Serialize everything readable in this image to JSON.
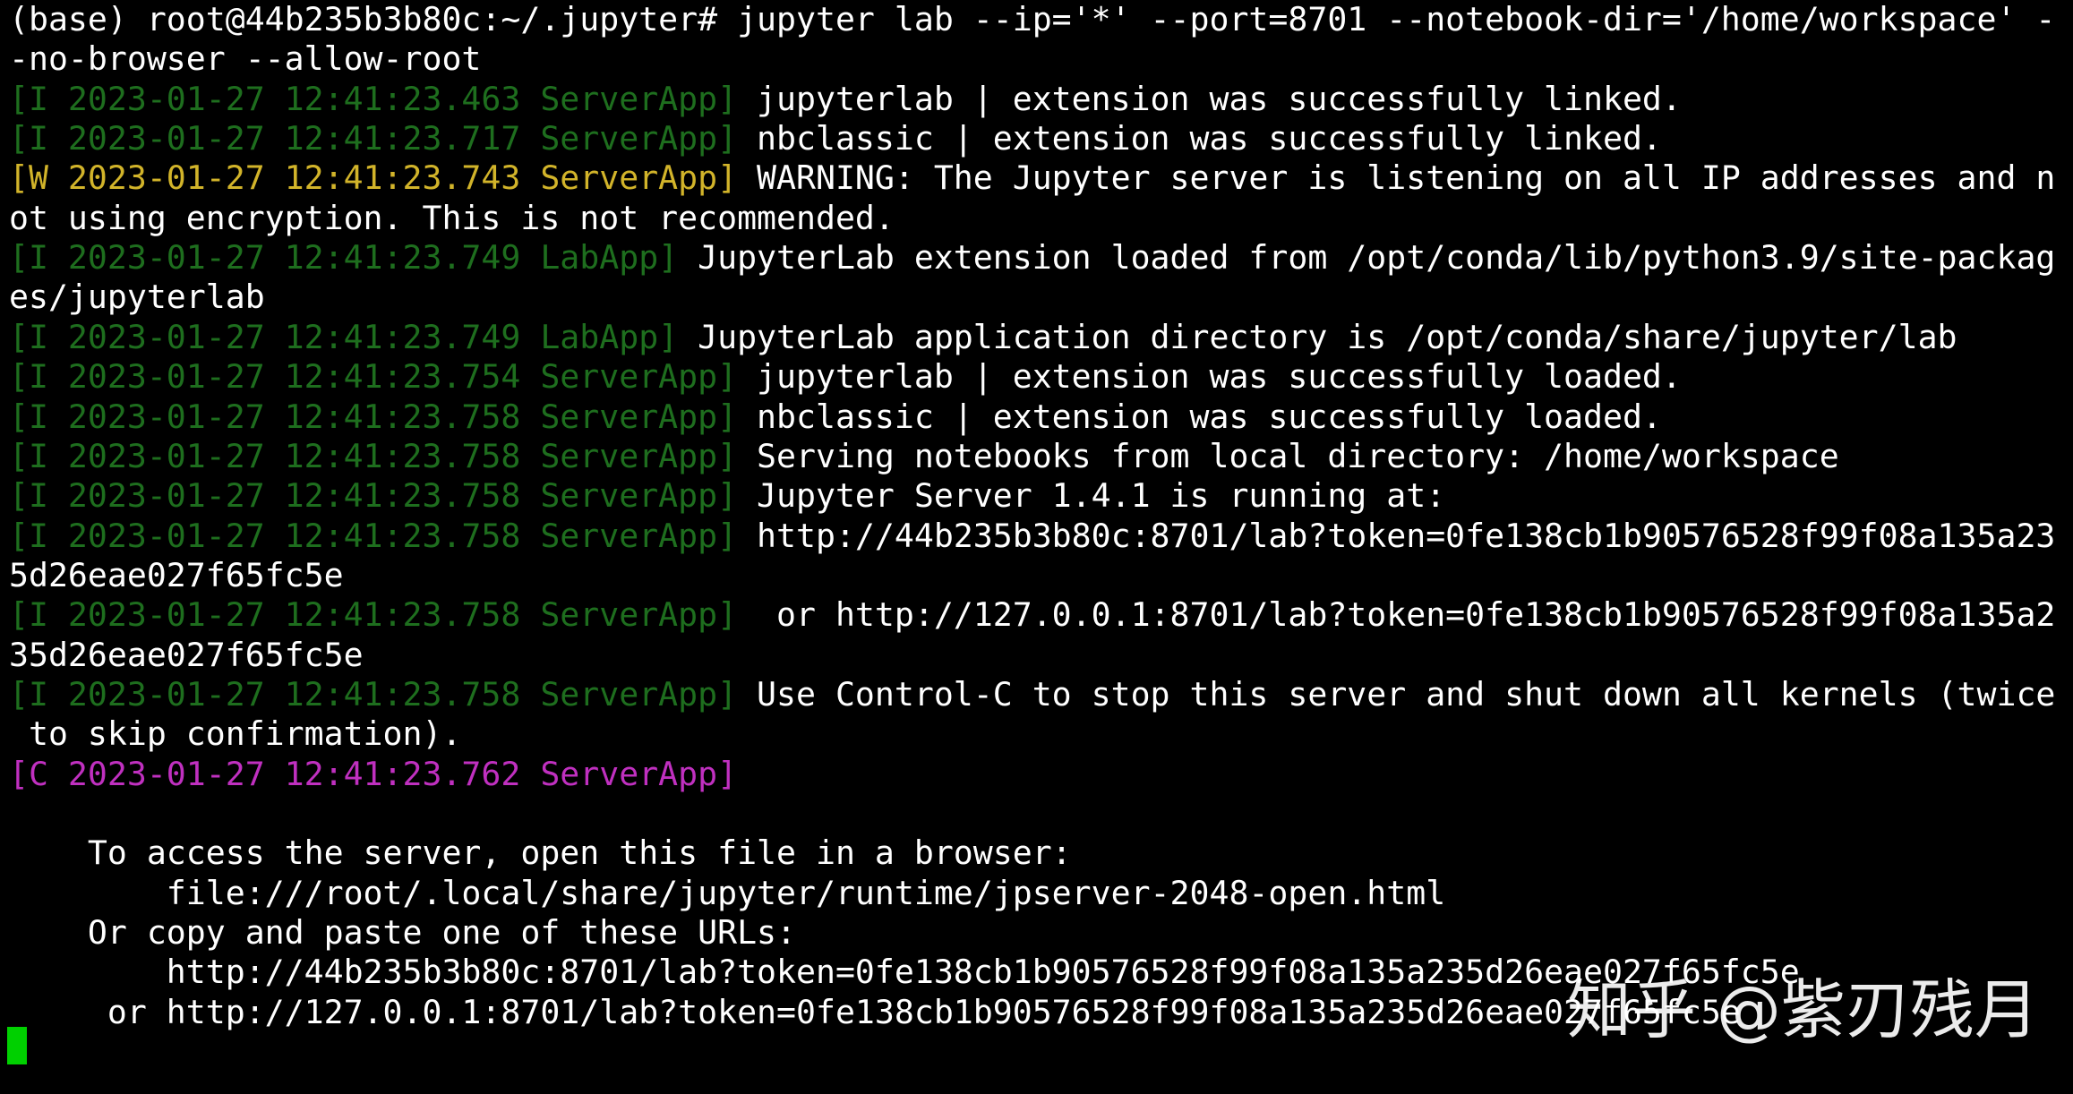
{
  "terminal": {
    "lines": [
      {
        "kind": "plain",
        "text": "(base) root@44b235b3b80c:~/.jupyter# jupyter lab --ip='*' --port=8701 --notebook-dir='/home/workspace' -"
      },
      {
        "kind": "plain",
        "text": "-no-browser --allow-root"
      },
      {
        "kind": "info",
        "tag": "[I 2023-01-27 12:41:23.463 ServerApp]",
        "message": " jupyterlab | extension was successfully linked."
      },
      {
        "kind": "info",
        "tag": "[I 2023-01-27 12:41:23.717 ServerApp]",
        "message": " nbclassic | extension was successfully linked."
      },
      {
        "kind": "warn",
        "tag": "[W 2023-01-27 12:41:23.743 ServerApp]",
        "message": " WARNING: The Jupyter server is listening on all IP addresses and n"
      },
      {
        "kind": "plain",
        "text": "ot using encryption. This is not recommended."
      },
      {
        "kind": "info",
        "tag": "[I 2023-01-27 12:41:23.749 LabApp]",
        "message": " JupyterLab extension loaded from /opt/conda/lib/python3.9/site-packag"
      },
      {
        "kind": "plain",
        "text": "es/jupyterlab"
      },
      {
        "kind": "info",
        "tag": "[I 2023-01-27 12:41:23.749 LabApp]",
        "message": " JupyterLab application directory is /opt/conda/share/jupyter/lab"
      },
      {
        "kind": "info",
        "tag": "[I 2023-01-27 12:41:23.754 ServerApp]",
        "message": " jupyterlab | extension was successfully loaded."
      },
      {
        "kind": "info",
        "tag": "[I 2023-01-27 12:41:23.758 ServerApp]",
        "message": " nbclassic | extension was successfully loaded."
      },
      {
        "kind": "info",
        "tag": "[I 2023-01-27 12:41:23.758 ServerApp]",
        "message": " Serving notebooks from local directory: /home/workspace"
      },
      {
        "kind": "info",
        "tag": "[I 2023-01-27 12:41:23.758 ServerApp]",
        "message": " Jupyter Server 1.4.1 is running at:"
      },
      {
        "kind": "info",
        "tag": "[I 2023-01-27 12:41:23.758 ServerApp]",
        "message": " http://44b235b3b80c:8701/lab?token=0fe138cb1b90576528f99f08a135a23"
      },
      {
        "kind": "plain",
        "text": "5d26eae027f65fc5e"
      },
      {
        "kind": "info",
        "tag": "[I 2023-01-27 12:41:23.758 ServerApp]",
        "message": "  or http://127.0.0.1:8701/lab?token=0fe138cb1b90576528f99f08a135a2"
      },
      {
        "kind": "plain",
        "text": "35d26eae027f65fc5e"
      },
      {
        "kind": "info",
        "tag": "[I 2023-01-27 12:41:23.758 ServerApp]",
        "message": " Use Control-C to stop this server and shut down all kernels (twice"
      },
      {
        "kind": "plain",
        "text": " to skip confirmation)."
      },
      {
        "kind": "crit",
        "tag": "[C 2023-01-27 12:41:23.762 ServerApp]",
        "message": ""
      },
      {
        "kind": "plain",
        "text": ""
      },
      {
        "kind": "plain",
        "text": "    To access the server, open this file in a browser:"
      },
      {
        "kind": "plain",
        "text": "        file:///root/.local/share/jupyter/runtime/jpserver-2048-open.html"
      },
      {
        "kind": "plain",
        "text": "    Or copy and paste one of these URLs:"
      },
      {
        "kind": "plain",
        "text": "        http://44b235b3b80c:8701/lab?token=0fe138cb1b90576528f99f08a135a235d26eae027f65fc5e"
      },
      {
        "kind": "plain",
        "text": "     or http://127.0.0.1:8701/lab?token=0fe138cb1b90576528f99f08a135a235d26eae027f65fc5e"
      }
    ]
  },
  "watermark": {
    "text": "知乎 @紫刃残月"
  },
  "colors": {
    "background": "#000000",
    "text": "#ffffff",
    "info_tag": "#1e6e1e",
    "warn_tag": "#d2b42a",
    "crit_tag": "#c030c0",
    "cursor": "#00d000"
  }
}
